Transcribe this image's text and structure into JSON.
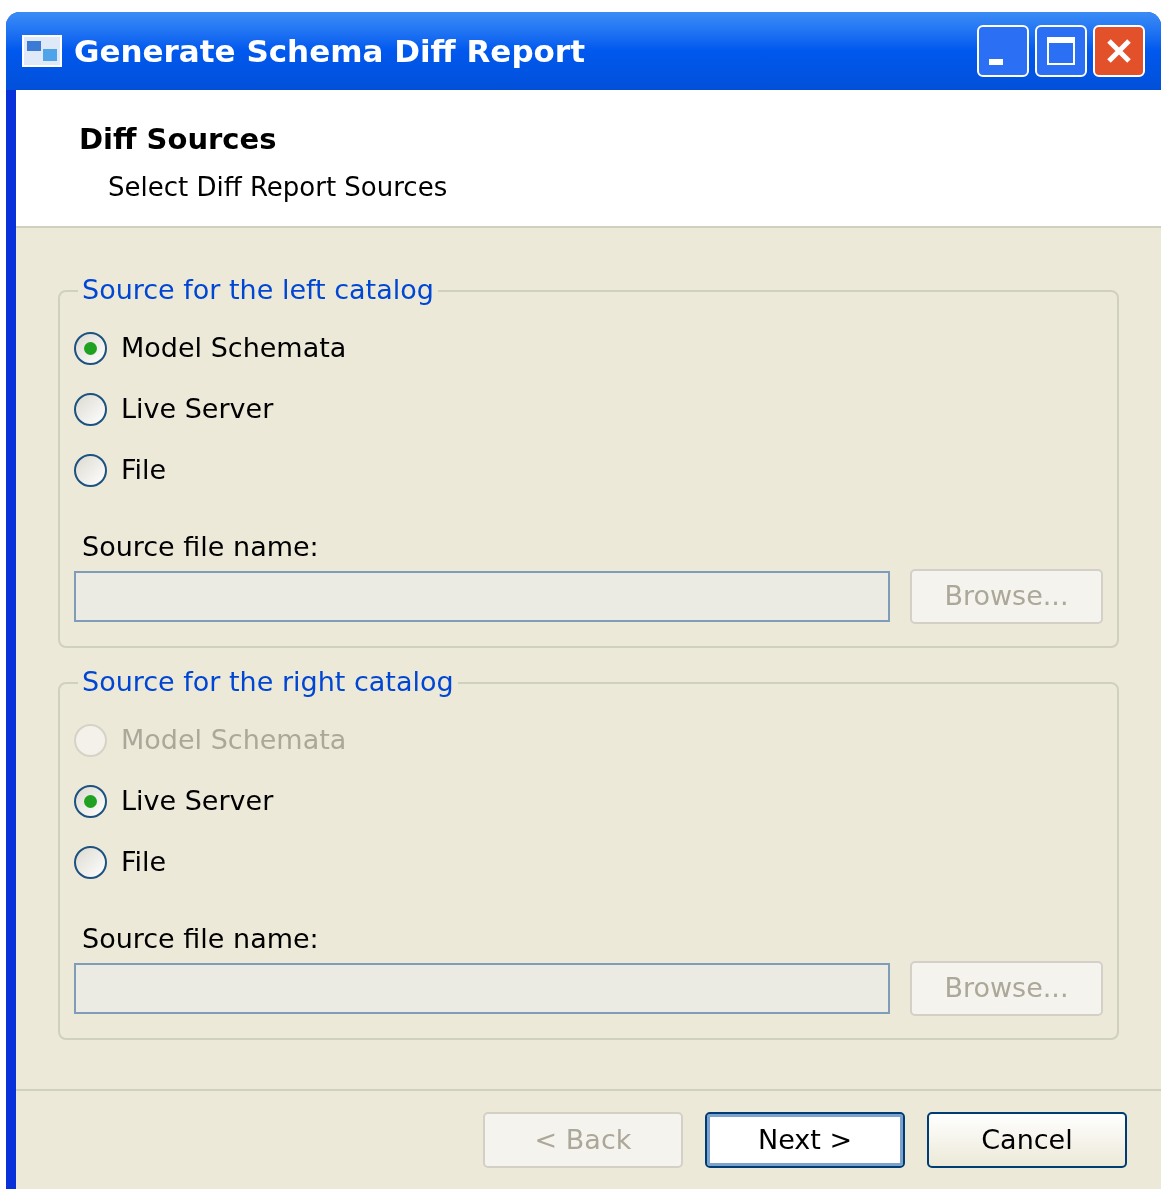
{
  "window": {
    "title": "Generate Schema Diff Report"
  },
  "header": {
    "title": "Diff Sources",
    "subtitle": "Select Diff Report Sources"
  },
  "groups": [
    {
      "title": "Source for the left catalog",
      "options": [
        {
          "label": "Model Schemata",
          "selected": true,
          "disabled": false
        },
        {
          "label": "Live Server",
          "selected": false,
          "disabled": false
        },
        {
          "label": "File",
          "selected": false,
          "disabled": false
        }
      ],
      "file_label": "Source file name:",
      "field": {
        "disabled": true
      },
      "browse": {
        "label": "Browse...",
        "disabled": true
      }
    },
    {
      "title": "Source for the right catalog",
      "options": [
        {
          "label": "Model Schemata",
          "selected": false,
          "disabled": true
        },
        {
          "label": "Live Server",
          "selected": true,
          "disabled": false
        },
        {
          "label": "File",
          "selected": false,
          "disabled": false
        }
      ],
      "file_label": "Source file name:",
      "field": {
        "disabled": true
      },
      "browse": {
        "label": "Browse...",
        "disabled": true
      }
    }
  ],
  "buttons": [
    {
      "label": "< Back",
      "disabled": true,
      "default": false
    },
    {
      "label": "Next >",
      "disabled": false,
      "default": true
    },
    {
      "label": "Cancel",
      "disabled": false,
      "default": false
    }
  ]
}
